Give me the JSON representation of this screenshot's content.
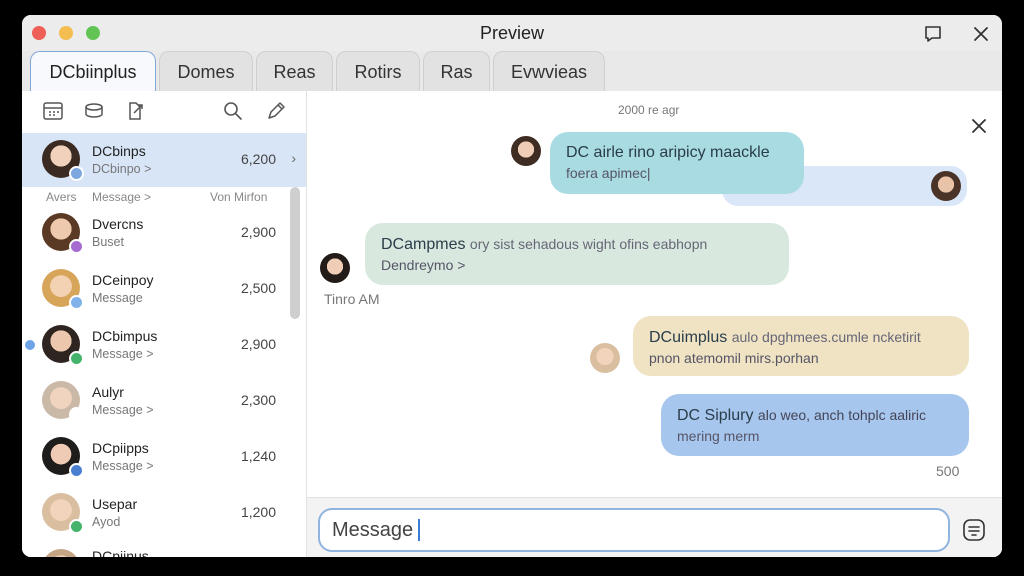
{
  "window": {
    "title": "Preview"
  },
  "tabs": [
    {
      "label": "DCbiinplus",
      "active": true
    },
    {
      "label": "Domes"
    },
    {
      "label": "Reas"
    },
    {
      "label": "Rotirs"
    },
    {
      "label": "Ras"
    },
    {
      "label": "Evwvieas"
    }
  ],
  "sidebar": {
    "toolbar_icons": [
      "calendar-icon",
      "cloud-drive-icon",
      "share-icon",
      "search-icon",
      "compose-icon"
    ],
    "header_left": "Avers",
    "header_mid": "Message >",
    "header_right": "Von Mirfon",
    "conversations": [
      {
        "name": "DCbinps",
        "sub": "DCbinpo >",
        "value": "6,200",
        "selected": true,
        "status": "#7ea7e0"
      },
      {
        "name": "Dvercns",
        "sub": "Buset",
        "value": "2,900",
        "status": "#a66bd1"
      },
      {
        "name": "DCeinpoy",
        "sub": "Message",
        "value": "2,500",
        "status": "#7fb2e8"
      },
      {
        "name": "DCbimpus",
        "sub": "Message >",
        "value": "2,900",
        "status": "#45b36b",
        "unread": true
      },
      {
        "name": "Aulyr",
        "sub": "Message >",
        "value": "2,300",
        "status": "#ffffff"
      },
      {
        "name": "DCpiipps",
        "sub": "Message >",
        "value": "1,240",
        "status": "#4a7fd0"
      },
      {
        "name": "Usepar",
        "sub": "Ayod",
        "value": "1,200",
        "status": "#45b36b"
      },
      {
        "name": "DCpiinus",
        "sub": "",
        "value": ""
      }
    ]
  },
  "chat": {
    "top_timestamp": "2000 re agr",
    "messages": [
      {
        "line1": "DC airle rino aripicy maackle",
        "line2": "foera apimec|",
        "color": "#a9dbe3"
      },
      {
        "line1": "DCampmes",
        "line1b": "ory sist sehadous wight ofins eabhopn",
        "line2": "Dendreymo >",
        "color": "#d9e8de"
      },
      {
        "line1": "DCuimplus",
        "line1b": "aulo dpghmees.cumle ncketirit",
        "line2": "pnon atemomil mirs.porhan",
        "color": "#efe3c3"
      },
      {
        "line1": "DC Siplury",
        "line1b": "alo weo, anch tohplc aaliric",
        "line2": "mering merm",
        "color": "#a7c6ee"
      }
    ],
    "timestamp_left": "Tinro AM",
    "count_right": "500",
    "composer": {
      "value": "Message"
    }
  }
}
